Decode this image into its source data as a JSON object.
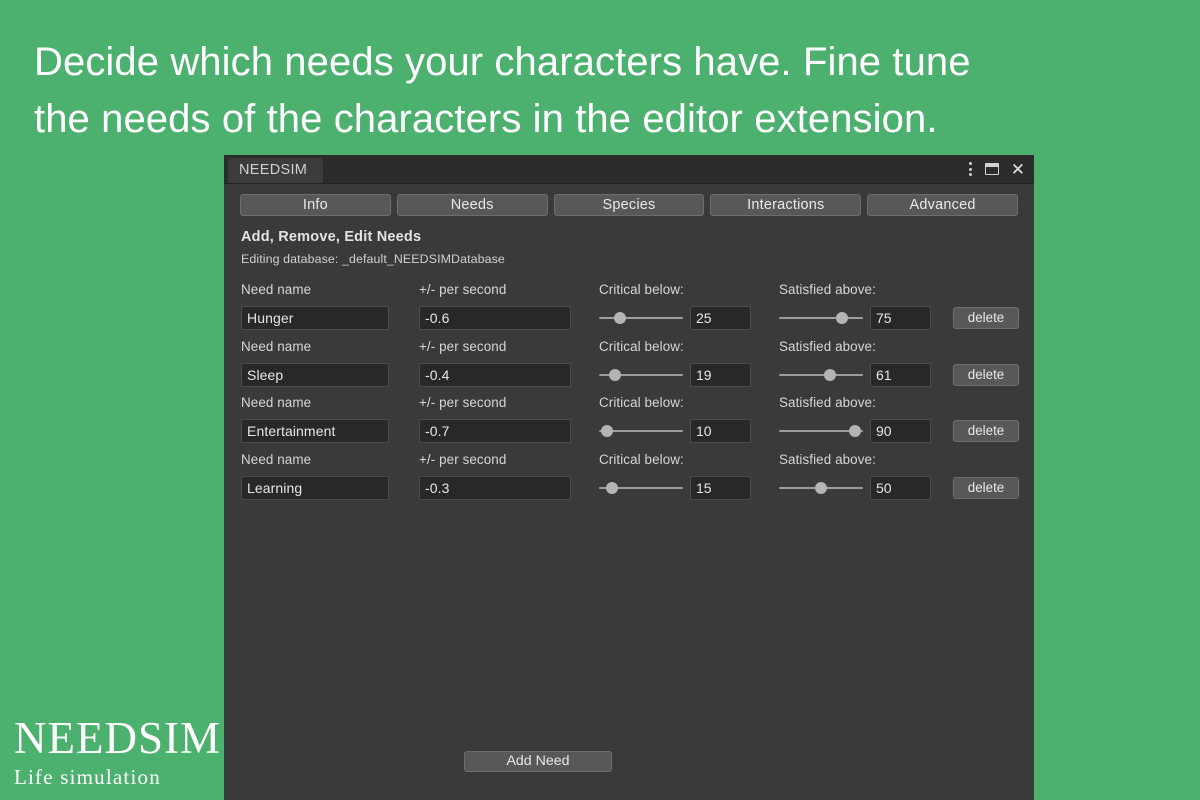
{
  "headline": "Decide which needs your characters have. Fine tune\nthe needs of the characters in the editor extension.",
  "brand": {
    "name": "NEEDSIM",
    "tagline": "Life  simulation"
  },
  "colors": {
    "background_green": "#4cb06e",
    "panel_body": "#3a3a3a",
    "titlebar": "#2c2c2c",
    "button_face": "#585858",
    "field_fill": "#282828",
    "text_primary": "#e6e6e6"
  },
  "window": {
    "tab_title": "NEEDSIM",
    "controls": [
      {
        "name": "kebab-menu-icon",
        "glyph": "⋮"
      },
      {
        "name": "maximize-icon",
        "glyph": "❐"
      },
      {
        "name": "close-icon",
        "glyph": "✕"
      }
    ]
  },
  "tabs": [
    {
      "label": "Info"
    },
    {
      "label": "Needs"
    },
    {
      "label": "Species"
    },
    {
      "label": "Interactions"
    },
    {
      "label": "Advanced"
    }
  ],
  "section": {
    "title": "Add, Remove, Edit Needs",
    "subtitle": "Editing database: _default_NEEDSIMDatabase"
  },
  "labels": {
    "need_name": "Need name",
    "rate": "+/- per second",
    "critical": "Critical below:",
    "satisfied": "Satisfied above:",
    "delete": "delete"
  },
  "slider_range": {
    "min": 0,
    "max": 100
  },
  "needs": [
    {
      "name": "Hunger",
      "rate": "-0.6",
      "critical_below": "25",
      "satisfied_above": "75",
      "delete_label": "delete"
    },
    {
      "name": "Sleep",
      "rate": "-0.4",
      "critical_below": "19",
      "satisfied_above": "61",
      "delete_label": "delete"
    },
    {
      "name": "Entertainment",
      "rate": "-0.7",
      "critical_below": "10",
      "satisfied_above": "90",
      "delete_label": "delete"
    },
    {
      "name": "Learning",
      "rate": "-0.3",
      "critical_below": "15",
      "satisfied_above": "50",
      "delete_label": "delete"
    }
  ],
  "footer": {
    "add_need_label": "Add Need"
  }
}
